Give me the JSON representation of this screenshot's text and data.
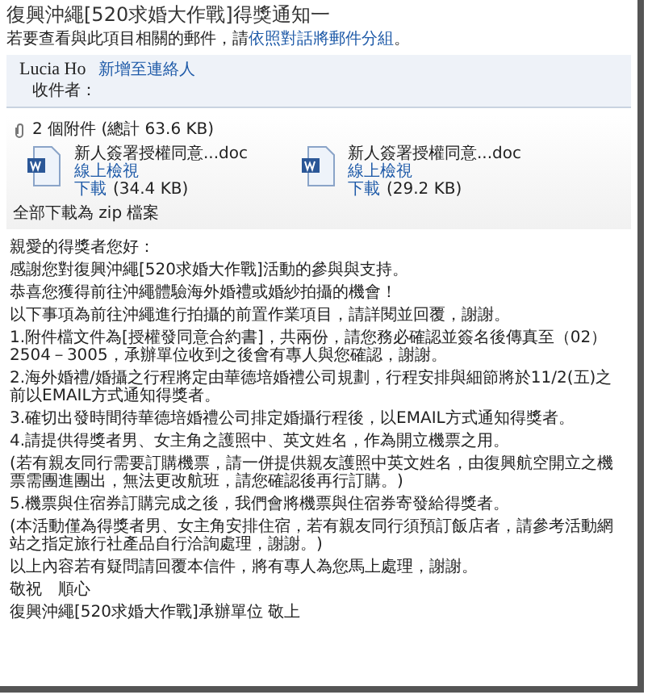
{
  "title": "復興沖繩[520求婚大作戰]得獎通知一",
  "info": {
    "text": "若要查看與此項目相關的郵件，請",
    "link": "依照對話將郵件分組",
    "end": "。"
  },
  "sender": {
    "name": "Lucia Ho",
    "add_contact": "新增至連絡人",
    "recipients_label": "收件者："
  },
  "attachments": {
    "summary": "2 個附件 (總計 63.6 KB)",
    "files": [
      {
        "name": "新人簽署授權同意...doc",
        "view": "線上檢視",
        "download": "下載",
        "size": "(34.4 KB)"
      },
      {
        "name": "新人簽署授權同意...doc",
        "view": "線上檢視",
        "download": "下載",
        "size": "(29.2 KB)"
      }
    ],
    "download_all": "全部下載為 zip 檔案"
  },
  "body": [
    "親愛的得獎者您好：",
    "感謝您對復興沖繩[520求婚大作戰]活動的參與與支持。",
    "恭喜您獲得前往沖繩體驗海外婚禮或婚紗拍攝的機會！",
    "以下事項為前往沖繩進行拍攝的前置作業項目，請詳閱並回覆，謝謝。",
    "1.附件檔文件為[授權發同意合約書]，共兩份，請您務必確認並簽名後傳真至（02）2504－3005，承辦單位收到之後會有專人與您確認，謝謝。",
    "2.海外婚禮/婚攝之行程將定由華德培婚禮公司規劃，行程安排與細節將於11/2(五)之前以EMAIL方式通知得獎者。",
    "3.確切出發時間待華德培婚禮公司排定婚攝行程後，以EMAIL方式通知得獎者。",
    "4.請提供得獎者男、女主角之護照中、英文姓名，作為開立機票之用。",
    "(若有親友同行需要訂購機票，請一併提供親友護照中英文姓名，由復興航空開立之機票需團進團出，無法更改航班，請您確認後再行訂購。)",
    "5.機票與住宿券訂購完成之後，我們會將機票與住宿券寄發給得獎者。",
    "(本活動僅為得獎者男、女主角安排住宿，若有親友同行須預訂飯店者，請參考活動網站之指定旅行社產品自行洽詢處理，謝謝。)",
    "以上內容若有疑問請回覆本信件，將有專人為您馬上處理，謝謝。",
    "敬祝　順心",
    "復興沖繩[520求婚大作戰]承辦單位 敬上"
  ]
}
